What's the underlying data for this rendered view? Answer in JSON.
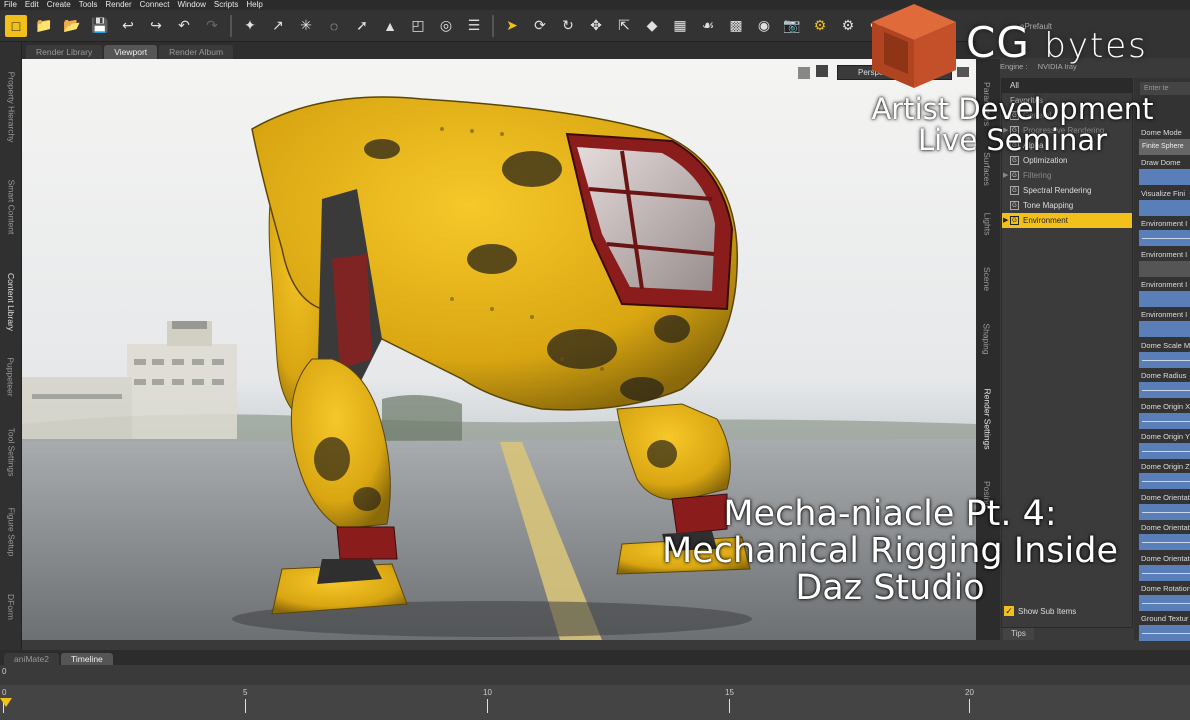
{
  "menu": [
    "File",
    "Edit",
    "Create",
    "Tools",
    "Render",
    "Connect",
    "Window",
    "Scripts",
    "Help"
  ],
  "left_dock_tabs": [
    "Property Hierarchy",
    "Smart Content",
    "Content Library",
    "Puppeteer",
    "Tool Settings",
    "Figure Setup",
    "DForm"
  ],
  "viewport_tabs": [
    "Render Library",
    "Viewport",
    "Render Album"
  ],
  "viewport": {
    "camera": "Perspe"
  },
  "right_vertical_tabs": [
    "Parameters",
    "Surfaces",
    "Lights",
    "Scene",
    "Shaping",
    "Render Settings",
    "Posing"
  ],
  "engine": {
    "label": "Engine :",
    "value": "NVIDIA Iray"
  },
  "render_groups": {
    "all": "All",
    "favorites": "Favorites",
    "items": [
      {
        "label": "General",
        "state": "dim",
        "expander": false
      },
      {
        "label": "Progressive Rendering",
        "state": "dim",
        "expander": true
      },
      {
        "label": "Alpha",
        "state": "normal",
        "expander": false
      },
      {
        "label": "Optimization",
        "state": "normal",
        "expander": false
      },
      {
        "label": "Filtering",
        "state": "dim",
        "expander": true
      },
      {
        "label": "Spectral Rendering",
        "state": "normal",
        "expander": false
      },
      {
        "label": "Tone Mapping",
        "state": "normal",
        "expander": false
      },
      {
        "label": "Environment",
        "state": "selected",
        "expander": true
      }
    ],
    "show_sub_items": "Show Sub Items",
    "tips_tab": "Tips"
  },
  "properties": {
    "search_placeholder": "Enter te",
    "items": [
      {
        "label": "Dome Mode",
        "field": "Finite Sphere",
        "kind": "plain"
      },
      {
        "label": "Draw Dome",
        "field": "",
        "kind": "toggle"
      },
      {
        "label": "Visualize Fini",
        "field": "",
        "kind": "toggle"
      },
      {
        "label": "Environment I",
        "field": "",
        "kind": "slider"
      },
      {
        "label": "Environment I",
        "field": "",
        "kind": "image"
      },
      {
        "label": "Environment I",
        "field": "",
        "kind": "toggle"
      },
      {
        "label": "Environment I",
        "field": "",
        "kind": "toggle"
      },
      {
        "label": "Dome Scale M",
        "field": "",
        "kind": "slider"
      },
      {
        "label": "Dome Radius",
        "field": "",
        "kind": "slider"
      },
      {
        "label": "Dome Origin X",
        "field": "",
        "kind": "slider"
      },
      {
        "label": "Dome Origin Y",
        "field": "",
        "kind": "slider"
      },
      {
        "label": "Dome Origin Z",
        "field": "",
        "kind": "slider"
      },
      {
        "label": "Dome Orientat",
        "field": "",
        "kind": "slider"
      },
      {
        "label": "Dome Orientat",
        "field": "",
        "kind": "slider"
      },
      {
        "label": "Dome Orientat",
        "field": "",
        "kind": "slider"
      },
      {
        "label": "Dome Rotation",
        "field": "",
        "kind": "slider"
      },
      {
        "label": "Ground Textur",
        "field": "",
        "kind": "slider"
      }
    ]
  },
  "upper_right_pane": {
    "label": "ePrefault"
  },
  "bottom_tabs": [
    "aniMate2",
    "Timeline"
  ],
  "timeline": {
    "start": "0",
    "ticks": [
      "5",
      "10",
      "15",
      "20"
    ]
  },
  "branding": {
    "brand_a": "CG",
    "brand_b": "bytes",
    "seminar_line1": "Artist Development",
    "seminar_line2": "Live Seminar",
    "title_line1": "Mecha-niacle Pt. 4:",
    "title_line2": "Mechanical Rigging Inside",
    "title_line3": "Daz Studio"
  },
  "colors": {
    "accent": "#f2c01a",
    "logo": "#c4502a",
    "param_blue": "#5a7fb8"
  }
}
